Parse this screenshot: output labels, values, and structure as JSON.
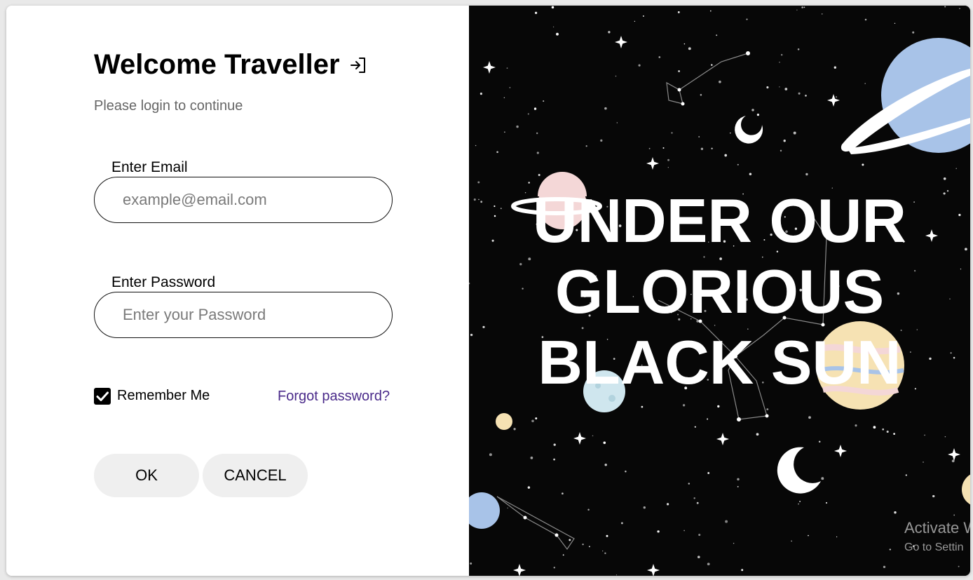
{
  "header": {
    "title": "Welcome Traveller",
    "login_icon": "login-arrow-icon",
    "subtitle": "Please login to continue"
  },
  "form": {
    "email_label": "Enter Email",
    "email_placeholder": "example@email.com",
    "email_value": "",
    "password_label": "Enter Password",
    "password_placeholder": "Enter your Password",
    "password_value": "",
    "remember_label": "Remember Me",
    "remember_checked": true,
    "forgot_link": "Forgot password?",
    "ok_button": "OK",
    "cancel_button": "CANCEL"
  },
  "banner": {
    "lines": [
      "UNDER OUR",
      "GLORIOUS",
      "BLACK SUN"
    ]
  },
  "watermark": {
    "title": "Activate W",
    "subtitle": "Go to Settin"
  },
  "colors": {
    "link": "#4a2a8a",
    "button_bg": "#efefef",
    "banner_bg": "#070707",
    "planet_blue": "#a8c3e8",
    "planet_pink": "#f4d7d7",
    "planet_cream": "#f6e2b3"
  }
}
